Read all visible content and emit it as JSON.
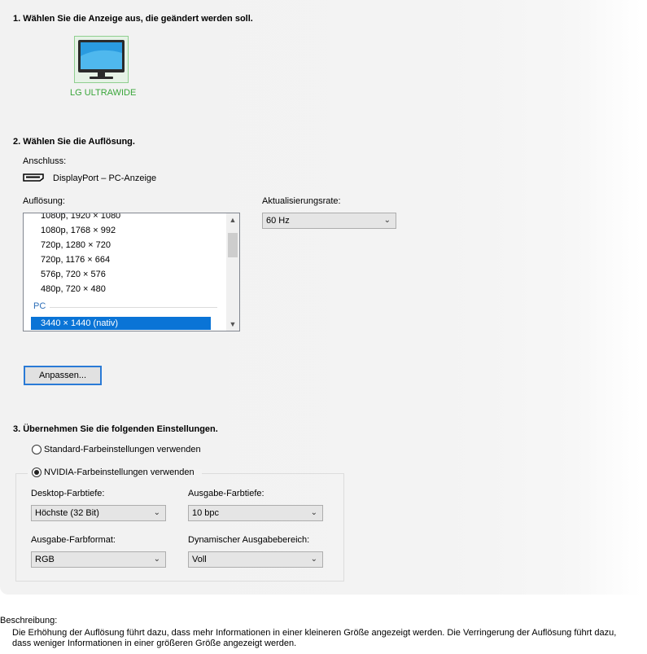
{
  "section1": {
    "heading": "1. Wählen Sie die Anzeige aus, die geändert werden soll.",
    "display_name": "LG ULTRAWIDE"
  },
  "section2": {
    "heading": "2. Wählen Sie die Auflösung.",
    "connection_label": "Anschluss:",
    "connection_value": "DisplayPort – PC-Anzeige",
    "resolution_label": "Auflösung:",
    "resolutions": [
      "1080p, 1920 × 1080",
      "1080p, 1768 × 992",
      "720p, 1280 × 720",
      "720p, 1176 × 664",
      "576p, 720 × 576",
      "480p, 720 × 480"
    ],
    "group_pc": "PC",
    "selected_resolution": "3440 × 1440 (nativ)",
    "refresh_label": "Aktualisierungsrate:",
    "refresh_value": "60 Hz",
    "customize_button": "Anpassen..."
  },
  "section3": {
    "heading": "3. Übernehmen Sie die folgenden Einstellungen.",
    "radio_default": "Standard-Farbeinstellungen verwenden",
    "radio_nvidia": "NVIDIA-Farbeinstellungen verwenden",
    "desktop_depth_label": "Desktop-Farbtiefe:",
    "desktop_depth_value": "Höchste (32 Bit)",
    "output_depth_label": "Ausgabe-Farbtiefe:",
    "output_depth_value": "10 bpc",
    "output_format_label": "Ausgabe-Farbformat:",
    "output_format_value": "RGB",
    "dynamic_range_label": "Dynamischer Ausgabebereich:",
    "dynamic_range_value": "Voll"
  },
  "description": {
    "label": "Beschreibung:",
    "text": "Die Erhöhung der Auflösung führt dazu, dass mehr Informationen in einer kleineren Größe angezeigt werden. Die Verringerung der Auflösung führt dazu, dass weniger Informationen in einer größeren Größe angezeigt werden."
  }
}
